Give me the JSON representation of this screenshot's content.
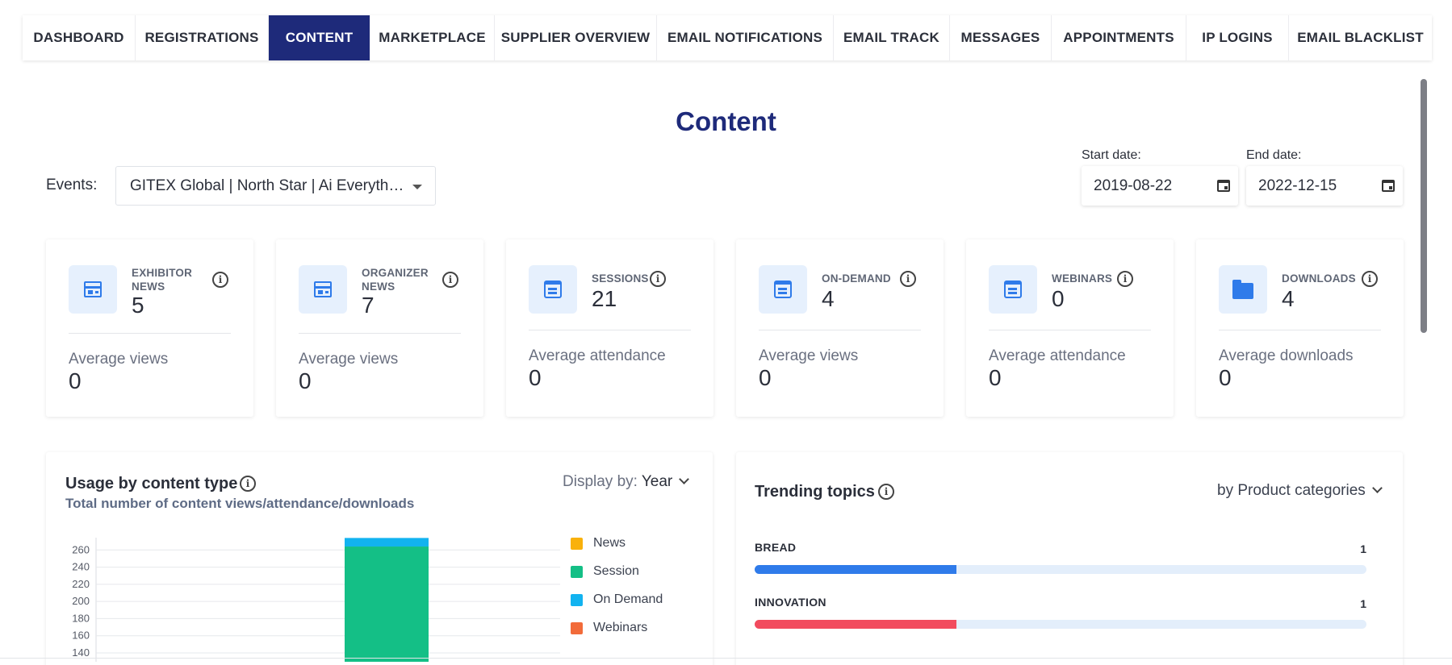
{
  "tabs": [
    {
      "label": "DASHBOARD",
      "active": false
    },
    {
      "label": "REGISTRATIONS",
      "active": false
    },
    {
      "label": "CONTENT",
      "active": true
    },
    {
      "label": "MARKETPLACE",
      "active": false
    },
    {
      "label": "SUPPLIER OVERVIEW",
      "active": false
    },
    {
      "label": "EMAIL NOTIFICATIONS",
      "active": false
    },
    {
      "label": "EMAIL TRACK",
      "active": false
    },
    {
      "label": "MESSAGES",
      "active": false
    },
    {
      "label": "APPOINTMENTS",
      "active": false
    },
    {
      "label": "IP LOGINS",
      "active": false
    },
    {
      "label": "EMAIL BLACKLIST",
      "active": false
    }
  ],
  "page": {
    "title": "Content"
  },
  "filters": {
    "events_label": "Events:",
    "events_value": "GITEX Global | North Star | Ai Everything | Future Blockchain",
    "start_label": "Start date:",
    "start_value": "2019-08-22",
    "end_label": "End date:",
    "end_value": "2022-12-15"
  },
  "cards": [
    {
      "title1": "EXHIBITOR",
      "title2": "NEWS",
      "value": "5",
      "sub_label": "Average views",
      "sub_value": "0",
      "icon": "news-icon"
    },
    {
      "title1": "ORGANIZER",
      "title2": "NEWS",
      "value": "7",
      "sub_label": "Average views",
      "sub_value": "0",
      "icon": "news-icon"
    },
    {
      "title1": "SESSIONS",
      "title2": "",
      "value": "21",
      "sub_label": "Average attendance",
      "sub_value": "0",
      "icon": "calendar-icon"
    },
    {
      "title1": "ON-DEMAND",
      "title2": "",
      "value": "4",
      "sub_label": "Average views",
      "sub_value": "0",
      "icon": "calendar-icon"
    },
    {
      "title1": "WEBINARS",
      "title2": "",
      "value": "0",
      "sub_label": "Average attendance",
      "sub_value": "0",
      "icon": "calendar-icon"
    },
    {
      "title1": "DOWNLOADS",
      "title2": "",
      "value": "4",
      "sub_label": "Average downloads",
      "sub_value": "0",
      "icon": "folder-icon"
    }
  ],
  "usage": {
    "title": "Usage by content type",
    "subtitle": "Total number of content views/attendance/downloads",
    "display_by_label": "Display by:",
    "display_by_value": "Year"
  },
  "trending": {
    "title": "Trending topics",
    "group_by": "by Product categories",
    "topics": [
      {
        "label": "BREAD",
        "count": "1",
        "color": "#2f7bea",
        "fraction": 0.33
      },
      {
        "label": "INNOVATION",
        "count": "1",
        "color": "#f24b5e",
        "fraction": 0.33
      }
    ]
  },
  "colors": {
    "accent": "#1e2a7a",
    "news": "#f9b10b",
    "session": "#14bf86",
    "on_demand": "#12b3f0",
    "webinars": "#f26b3a"
  },
  "chart_data": {
    "type": "bar",
    "stacked": true,
    "title": "",
    "xlabel": "",
    "ylabel": "",
    "yticks": [
      "140",
      "160",
      "180",
      "200",
      "220",
      "240",
      "260"
    ],
    "ylim_visible": [
      140,
      280
    ],
    "categories": [
      ""
    ],
    "series": [
      {
        "name": "News",
        "color": "#f9b10b",
        "values": [
          0
        ]
      },
      {
        "name": "Session",
        "color": "#14bf86",
        "values": [
          264
        ]
      },
      {
        "name": "On Demand",
        "color": "#12b3f0",
        "values": [
          10
        ]
      },
      {
        "name": "Webinars",
        "color": "#f26b3a",
        "values": [
          0
        ]
      }
    ],
    "legend_position": "right"
  }
}
